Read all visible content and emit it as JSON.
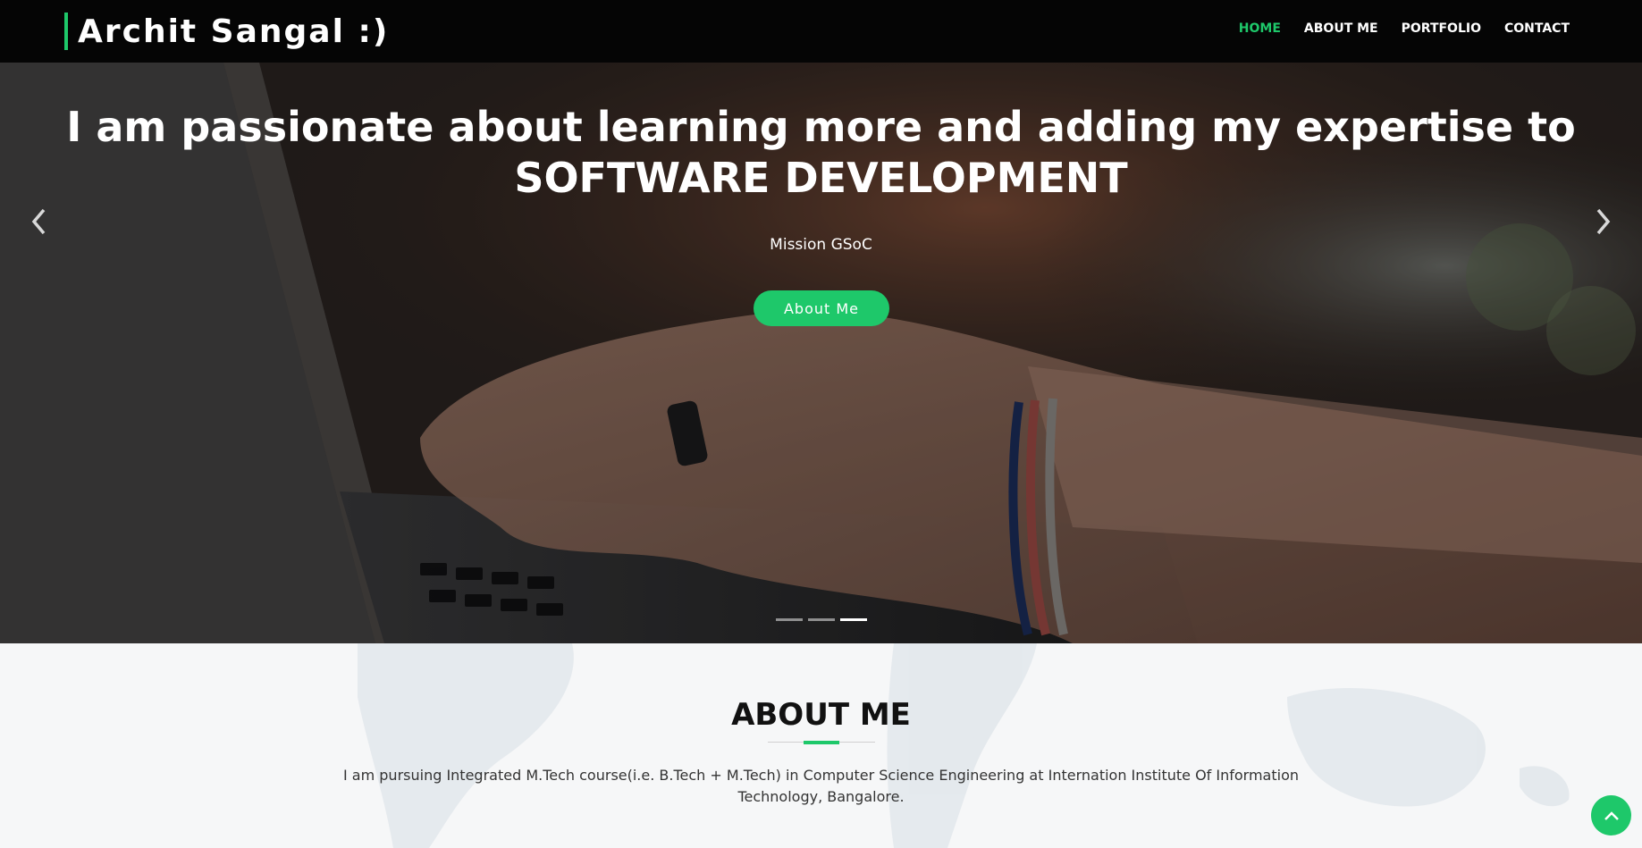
{
  "brand": {
    "name": "Archit Sangal :)"
  },
  "nav": {
    "items": [
      {
        "label": "HOME",
        "active": true
      },
      {
        "label": "ABOUT ME",
        "active": false
      },
      {
        "label": "PORTFOLIO",
        "active": false
      },
      {
        "label": "CONTACT",
        "active": false
      }
    ]
  },
  "hero": {
    "heading_line1": "I am passionate about learning more and adding my expertise to",
    "heading_line2": "SOFTWARE DEVELOPMENT",
    "subtitle": "Mission GSoC",
    "button_label": "About Me",
    "prev_icon": "chevron-left-icon",
    "next_icon": "chevron-right-icon",
    "slides_total": 3,
    "active_slide": 3
  },
  "about": {
    "title": "ABOUT ME",
    "text": "I am pursuing Integrated M.Tech course(i.e. B.Tech + M.Tech) in Computer Science Engineering at Internation Institute Of Information Technology, Bangalore."
  },
  "scroll_top": {
    "icon": "chevron-up-icon"
  },
  "colors": {
    "accent": "#1ec86a",
    "navbar_bg": "#050505",
    "about_bg": "#f6f7f8",
    "text_dark": "#111111"
  }
}
